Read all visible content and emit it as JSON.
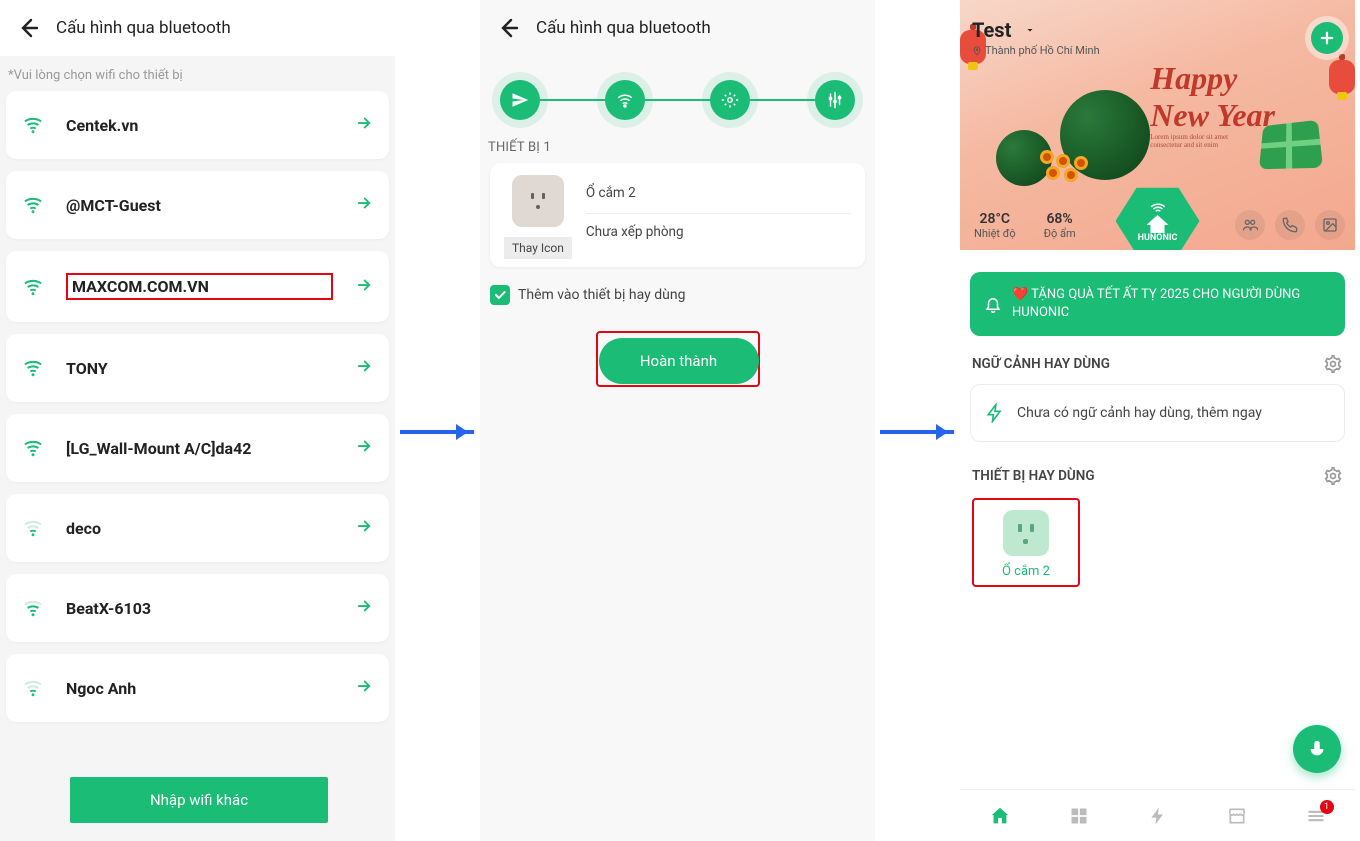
{
  "screen1": {
    "header_title": "Cấu hình qua bluetooth",
    "hint": "*Vui lòng chọn wifi cho thiết bị",
    "wifi_list": [
      {
        "name": "Centek.vn",
        "strength": "high"
      },
      {
        "name": "@MCT-Guest",
        "strength": "high"
      },
      {
        "name": "MAXCOM.COM.VN",
        "strength": "high",
        "highlighted": true
      },
      {
        "name": "TONY",
        "strength": "high"
      },
      {
        "name": "[LG_Wall-Mount A/C]da42",
        "strength": "high"
      },
      {
        "name": "deco",
        "strength": "low"
      },
      {
        "name": "BeatX-6103",
        "strength": "mid"
      },
      {
        "name": "Ngoc Anh",
        "strength": "low"
      }
    ],
    "other_wifi_btn": "Nhập wifi khác"
  },
  "screen2": {
    "header_title": "Cấu hình qua bluetooth",
    "section_label": "THIẾT BỊ 1",
    "device": {
      "name": "Ổ cắm 2",
      "room": "Chưa xếp phòng",
      "change_icon_label": "Thay Icon"
    },
    "checkbox_label": "Thêm vào thiết bị hay dùng",
    "checkbox_checked": true,
    "done_btn": "Hoàn thành"
  },
  "screen3": {
    "home_name": "Test",
    "location": "Thành phố Hồ Chí Minh",
    "greeting_l1": "Happy",
    "greeting_l2": "New Year",
    "greeting_sub": "Lorem ipsum dolor sit amet consectetur and sit enim",
    "brand": "HUNONIC",
    "temperature_value": "28°C",
    "temperature_label": "Nhiệt độ",
    "humidity_value": "68%",
    "humidity_label": "Độ ẩm",
    "banner_text": "❤️ TẶNG QUÀ TẾT ẤT TỴ 2025 CHO NGƯỜI DÙNG HUNONIC",
    "section_scene": "NGỮ CẢNH HAY DÙNG",
    "scene_empty": "Chưa có ngữ cảnh hay dùng, thêm ngay",
    "section_device": "THIẾT BỊ HAY DÙNG",
    "device_tile_label": "Ổ cắm 2",
    "nav_badge": "1"
  }
}
